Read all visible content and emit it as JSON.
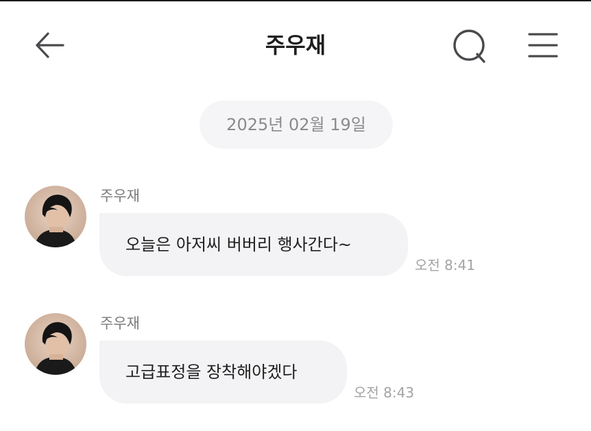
{
  "header": {
    "title": "주우재",
    "back_icon": "arrow-left-icon",
    "search_icon": "search-icon",
    "menu_icon": "hamburger-menu-icon"
  },
  "date_separator": "2025년 02월 19일",
  "messages": [
    {
      "sender": "주우재",
      "text": "오늘은 아저씨 버버리 행사간다~",
      "time": "오전 8:41"
    },
    {
      "sender": "주우재",
      "text": "고급표정을 장착해야겠다",
      "time": "오전 8:43"
    }
  ],
  "colors": {
    "bubble": "#f3f3f5",
    "date_pill": "#f5f5f7",
    "icon": "#4a4a4e"
  }
}
